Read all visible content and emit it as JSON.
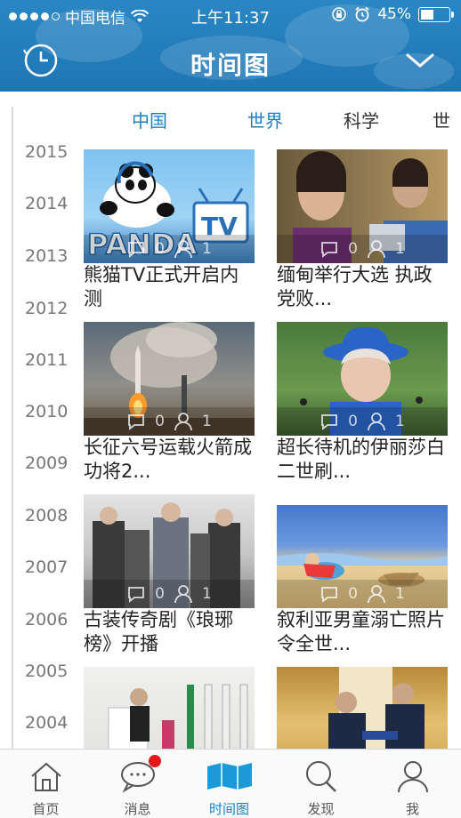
{
  "status_bar": {
    "carrier": "中国电信",
    "time": "上午11:37",
    "battery": "45%",
    "battery_level": 0.45
  },
  "nav": {
    "title": "时间图"
  },
  "tabs": [
    {
      "label": "中国",
      "active": true
    },
    {
      "label": "世界",
      "active": true
    },
    {
      "label": "科学",
      "active": false
    },
    {
      "label": "世",
      "active": false
    }
  ],
  "years": [
    "2015",
    "2014",
    "2013",
    "2012",
    "2011",
    "2010",
    "2009",
    "2008",
    "2007",
    "2006",
    "2005",
    "2004"
  ],
  "cards": [
    {
      "caption": "熊猫TV正式开启内测",
      "comments": "0",
      "likes": "1"
    },
    {
      "caption": "缅甸举行大选 执政党败...",
      "comments": "0",
      "likes": "1"
    },
    {
      "caption": "长征六号运载火箭成功将2...",
      "comments": "0",
      "likes": "1"
    },
    {
      "caption": "超长待机的伊丽莎白二世刷...",
      "comments": "0",
      "likes": "1"
    },
    {
      "caption": "古装传奇剧《琅琊榜》开播",
      "comments": "0",
      "likes": "1"
    },
    {
      "caption": "叙利亚男童溺亡照片令全世...",
      "comments": "0",
      "likes": "1"
    },
    {
      "caption": "",
      "comments": "",
      "likes": ""
    },
    {
      "caption": "",
      "comments": "",
      "likes": ""
    }
  ],
  "thumb_texts": {
    "panda": "PANDA",
    "tv": "TV"
  },
  "tabbar": [
    {
      "label": "首页",
      "icon": "home-icon"
    },
    {
      "label": "消息",
      "icon": "message-icon"
    },
    {
      "label": "时间图",
      "icon": "map-icon"
    },
    {
      "label": "发现",
      "icon": "search-icon"
    },
    {
      "label": "我",
      "icon": "person-icon"
    }
  ],
  "colors": {
    "header": "#1f76b4",
    "accent": "#1a80c4",
    "badge": "#e8161c"
  }
}
